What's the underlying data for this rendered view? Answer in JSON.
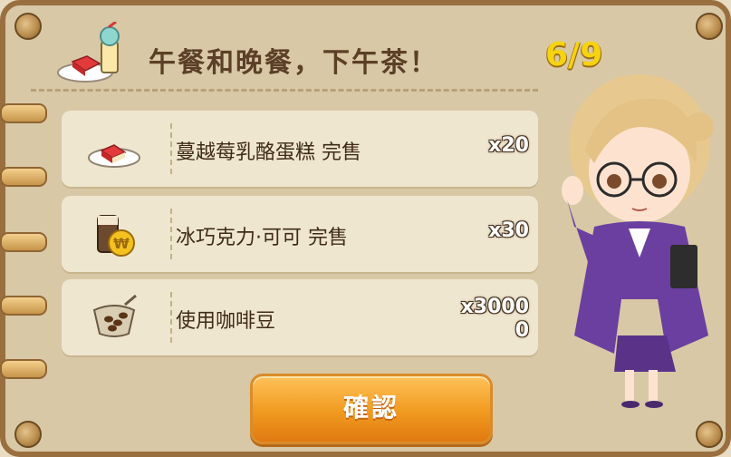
{
  "header": {
    "title": "午餐和晚餐，下午茶！",
    "count": "6/9",
    "icon": "cake-and-sundae-icon"
  },
  "items": [
    {
      "label": "蔓越莓乳酪蛋糕 完售",
      "qty": "x20",
      "icon": "cranberry-cheesecake-icon"
    },
    {
      "label": "冰巧克力·可可 完售",
      "qty": "x30",
      "icon": "iced-chocolate-cocoa-icon"
    },
    {
      "label": "使用咖啡豆",
      "qty": "x30000",
      "icon": "coffee-beans-icon"
    }
  ],
  "confirm_label": "確認",
  "colors": {
    "accent": "#f09a1f",
    "count": "#f5d311",
    "panel": "#d8c8a6"
  }
}
